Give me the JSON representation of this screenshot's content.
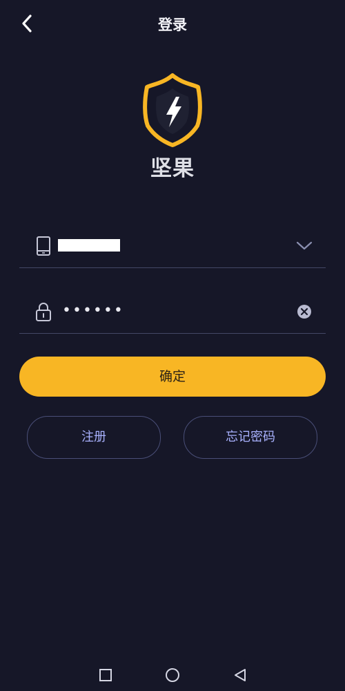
{
  "header": {
    "title": "登录",
    "back_icon": "chevron-left-icon"
  },
  "logo": {
    "icon": "lightning-shield-icon",
    "app_name": "坚果",
    "accent": "#f8b624"
  },
  "form": {
    "phone": {
      "icon": "phone-icon",
      "dropdown_icon": "chevron-down-icon"
    },
    "password": {
      "icon": "lock-icon",
      "value": "••••••",
      "clear_icon": "clear-circle-icon"
    },
    "confirm_label": "确定",
    "register_label": "注册",
    "forgot_label": "忘记密码"
  },
  "system_nav": {
    "recent_icon": "square-icon",
    "home_icon": "circle-icon",
    "back_icon": "triangle-back-icon"
  },
  "colors": {
    "background": "#161728",
    "primary": "#f8b624",
    "outline": "#4a4f78",
    "link_text": "#a9b2ff"
  }
}
